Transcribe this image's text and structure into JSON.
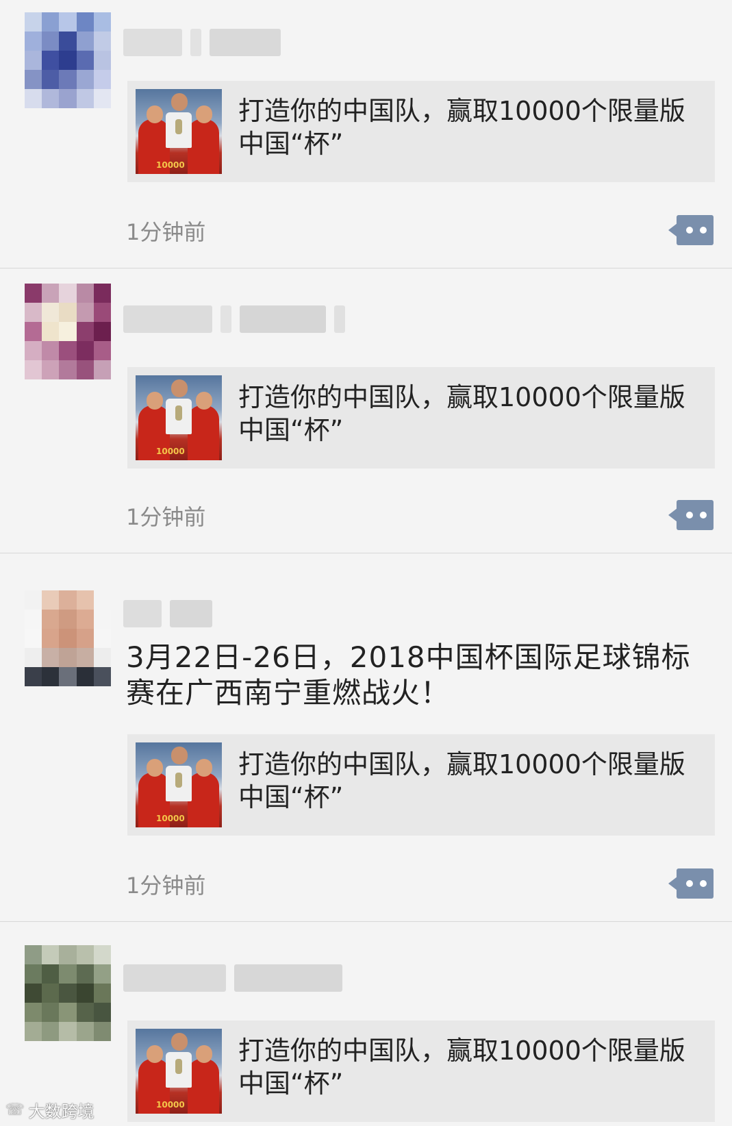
{
  "feed": {
    "posts": [
      {
        "text": "",
        "card": {
          "title": "打造你的中国队，赢取10000个限量版中国“杯”"
        },
        "time": "1分钟前",
        "avatar_colors": [
          "#c7d3ea",
          "#8aa0d2",
          "#b7c6e8",
          "#6d86c4",
          "#a9bde3",
          "#9fb0dc",
          "#7b8cc4",
          "#3a4c9a",
          "#8fa0d0",
          "#c1cbe6",
          "#aab6dc",
          "#3f4fa1",
          "#2d3d8f",
          "#5a6bb1",
          "#b9c3e2",
          "#8593c5",
          "#4d5da6",
          "#6c7ab8",
          "#9aa7d3",
          "#c5ccea",
          "#d7dced",
          "#b0b8db",
          "#9aa3cf",
          "#c0c8e4",
          "#e3e6f2"
        ]
      },
      {
        "text": "",
        "card": {
          "title": "打造你的中国队，赢取10000个限量版中国“杯”"
        },
        "time": "1分钟前",
        "avatar_colors": [
          "#8a3a6a",
          "#c9a3b8",
          "#e6d3dc",
          "#b98aa5",
          "#7a2b5c",
          "#d8b9c8",
          "#f0e8d8",
          "#e9dcc4",
          "#c49ab0",
          "#9a4a78",
          "#b46b94",
          "#efe4cc",
          "#f6f0de",
          "#8c3e6d",
          "#6c1f4e",
          "#d5aec2",
          "#c08aa8",
          "#9b4f7d",
          "#7c2d5f",
          "#a85d88",
          "#e2c6d3",
          "#cda2b8",
          "#b27a9b",
          "#98527c",
          "#c6a0b6"
        ]
      },
      {
        "text": "3月22日-26日，2018中国杯国际足球锦标赛在广西南宁重燃战火！",
        "card": {
          "title": "打造你的中国队，赢取10000个限量版中国“杯”"
        },
        "time": "1分钟前",
        "avatar_colors": [
          "#f2f2f2",
          "#e9cbb8",
          "#dcb09a",
          "#e6c2ad",
          "#f4f4f4",
          "#f6f6f6",
          "#d9a88f",
          "#cf9b82",
          "#dcab93",
          "#f5f5f5",
          "#f7f7f7",
          "#d8a48b",
          "#cc9379",
          "#d6a189",
          "#f6f6f6",
          "#eeeeee",
          "#c8b0a6",
          "#bfa396",
          "#c7aea2",
          "#ededed",
          "#3a3f4a",
          "#2c313a",
          "#6a6f7a",
          "#2a2f38",
          "#4a505c"
        ]
      },
      {
        "text": "",
        "card": {
          "title": "打造你的中国队，赢取10000个限量版中国“杯”"
        },
        "time": "",
        "avatar_colors": [
          "#8f9c86",
          "#c4cbb9",
          "#a8b09b",
          "#b9c0ac",
          "#d3d8cb",
          "#6b7b5f",
          "#4f5e44",
          "#7d8b6f",
          "#5d6b52",
          "#93a086",
          "#3f4a34",
          "#5c6a4d",
          "#4a5640",
          "#3a4530",
          "#6a7759",
          "#7d8a6c",
          "#6a785b",
          "#899577",
          "#56634a",
          "#485540",
          "#a3ac94",
          "#8e9a80",
          "#b5bca7",
          "#9ba58c",
          "#7f8b71"
        ]
      }
    ]
  },
  "watermark": {
    "text": "大数跨境"
  }
}
